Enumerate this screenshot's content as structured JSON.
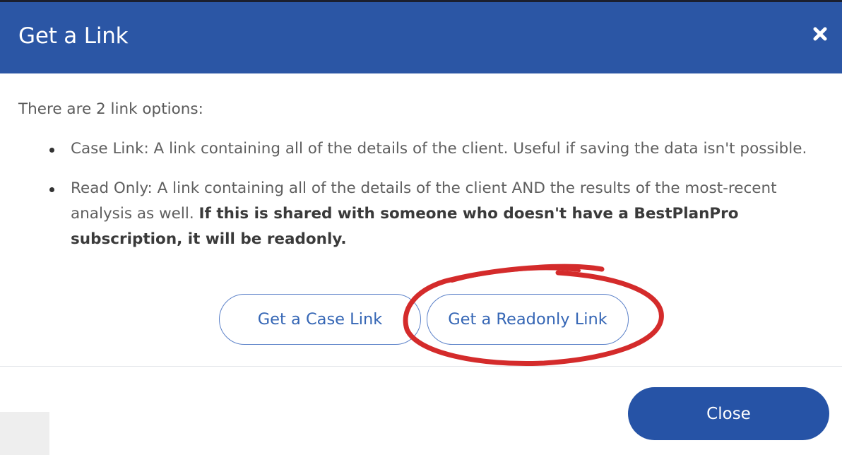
{
  "dialog": {
    "title": "Get a Link",
    "close_icon": "close-icon",
    "intro": "There are 2 link options:",
    "options": [
      {
        "text": "Case Link: A link containing all of the details of the client. Useful if saving the data isn't possible."
      },
      {
        "text": "Read Only: A link containing all of the details of the client AND the results of the most-recent analysis as well. ",
        "bold": "If this is shared with someone who doesn't have a BestPlanPro subscription, it will be readonly."
      }
    ],
    "buttons": {
      "case_link": "Get a Case Link",
      "readonly_link": "Get a Readonly Link",
      "close": "Close"
    }
  },
  "colors": {
    "header_bg": "#2b56a5",
    "primary_button": "#2653a6",
    "outline_button": "#5c82c9",
    "annotation_circle": "#d42b2b"
  }
}
